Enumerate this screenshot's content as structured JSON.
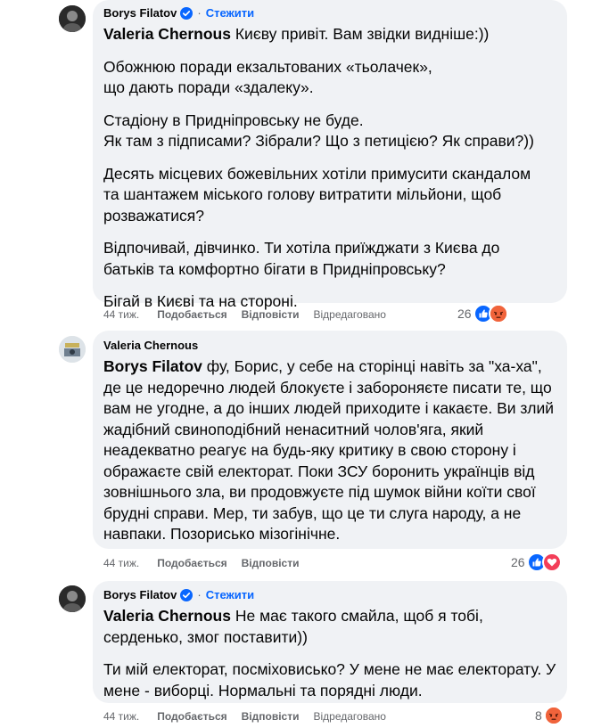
{
  "comments": [
    {
      "author": "Borys Filatov",
      "follow": "Стежити",
      "mention": "Valeria Chernous",
      "first_text": " Києву привіт. Вам звідки видніше:))",
      "paragraphs": [
        "Обожнюю поради екзальтованих «тьолачек»,\nщо дають поради «здалеку».",
        "Стадіону в Придніпровську не буде.\nЯк там з підписами? Зібрали? Що з петицією? Як справи?))",
        "Десять місцевих божевільних хотіли примусити скандалом та шантажем міського голову витратити мільйони, щоб розважатися?",
        "Відпочивай, дівчинко. Ти хотіла приїжджати з Києва до батьків та комфортно бігати в Придніпровську?",
        "Бігай в Києві та на стороні."
      ],
      "time": "44 тиж.",
      "like": "Подобається",
      "reply": "Відповісти",
      "edited": "Відредаговано",
      "reactions_count": "26",
      "reactions": [
        "like",
        "angry"
      ]
    },
    {
      "author": "Valeria Chernous",
      "mention": "Borys Filatov",
      "first_text": " фу, Борис, у себе на сторінці навіть за \"ха-ха\", де це недоречно людей блокуєте і забороняєте писати те, що вам не угодне, а до інших людей приходите і какаєте. Ви злий жадібний свиноподібний ненаситний чолов'яга, який неадекватно реагує на будь-яку критику в свою сторону і ображаєте свій електорат. Поки ЗСУ боронить українців від зовнішнього зла, ви продовжуєте під шумок війни коїти свої брудні справи. Мер, ти забув, що це ти слуга народу, а не навпаки. Позорисько мізогінічне.",
      "time": "44 тиж.",
      "like": "Подобається",
      "reply": "Відповісти",
      "reactions_count": "26",
      "reactions": [
        "like",
        "love"
      ]
    },
    {
      "author": "Borys Filatov",
      "follow": "Стежити",
      "mention": "Valeria Chernous",
      "first_text": " Не має такого смайла, щоб я тобі, серденько, змог поставити))",
      "paragraphs": [
        "Ти мій електорат, посміховисько? У мене не має електорату. У мене - виборці. Нормальні та порядні люди."
      ],
      "time": "44 тиж.",
      "like": "Подобається",
      "reply": "Відповісти",
      "edited": "Відредаговано",
      "reactions_count": "8",
      "reactions": [
        "angry"
      ]
    }
  ],
  "colors": {
    "bubble": "#f0f2f5",
    "link": "#0866ff",
    "secondary_text": "#65676b",
    "like": "#0866ff",
    "love": "#f33e58",
    "angry": "#f0633b"
  },
  "icons": {
    "verified": "verified-badge-icon",
    "like": "like-reaction-icon",
    "love": "love-reaction-icon",
    "angry": "angry-reaction-icon"
  }
}
